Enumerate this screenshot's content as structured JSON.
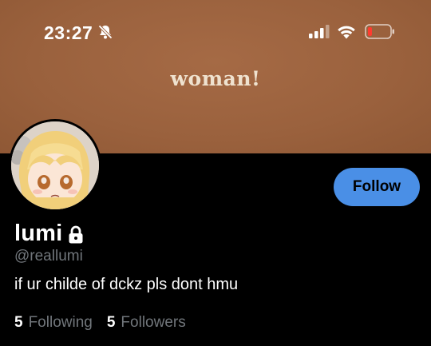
{
  "status_bar": {
    "time": "23:27",
    "icons": [
      "bell-slash-icon",
      "cellular-signal-icon",
      "wifi-icon",
      "battery-low-icon"
    ]
  },
  "banner": {
    "text": "woman!",
    "color": "#9e6440"
  },
  "profile": {
    "display_name": "lumi",
    "handle": "@reallumi",
    "bio": "if ur childe of dckz pls dont hmu",
    "protected_icon": "lock-icon"
  },
  "actions": {
    "follow_label": "Follow",
    "accent": "#4a8fe6"
  },
  "stats": {
    "following_count": "5",
    "following_label": "Following",
    "followers_count": "5",
    "followers_label": "Followers"
  }
}
